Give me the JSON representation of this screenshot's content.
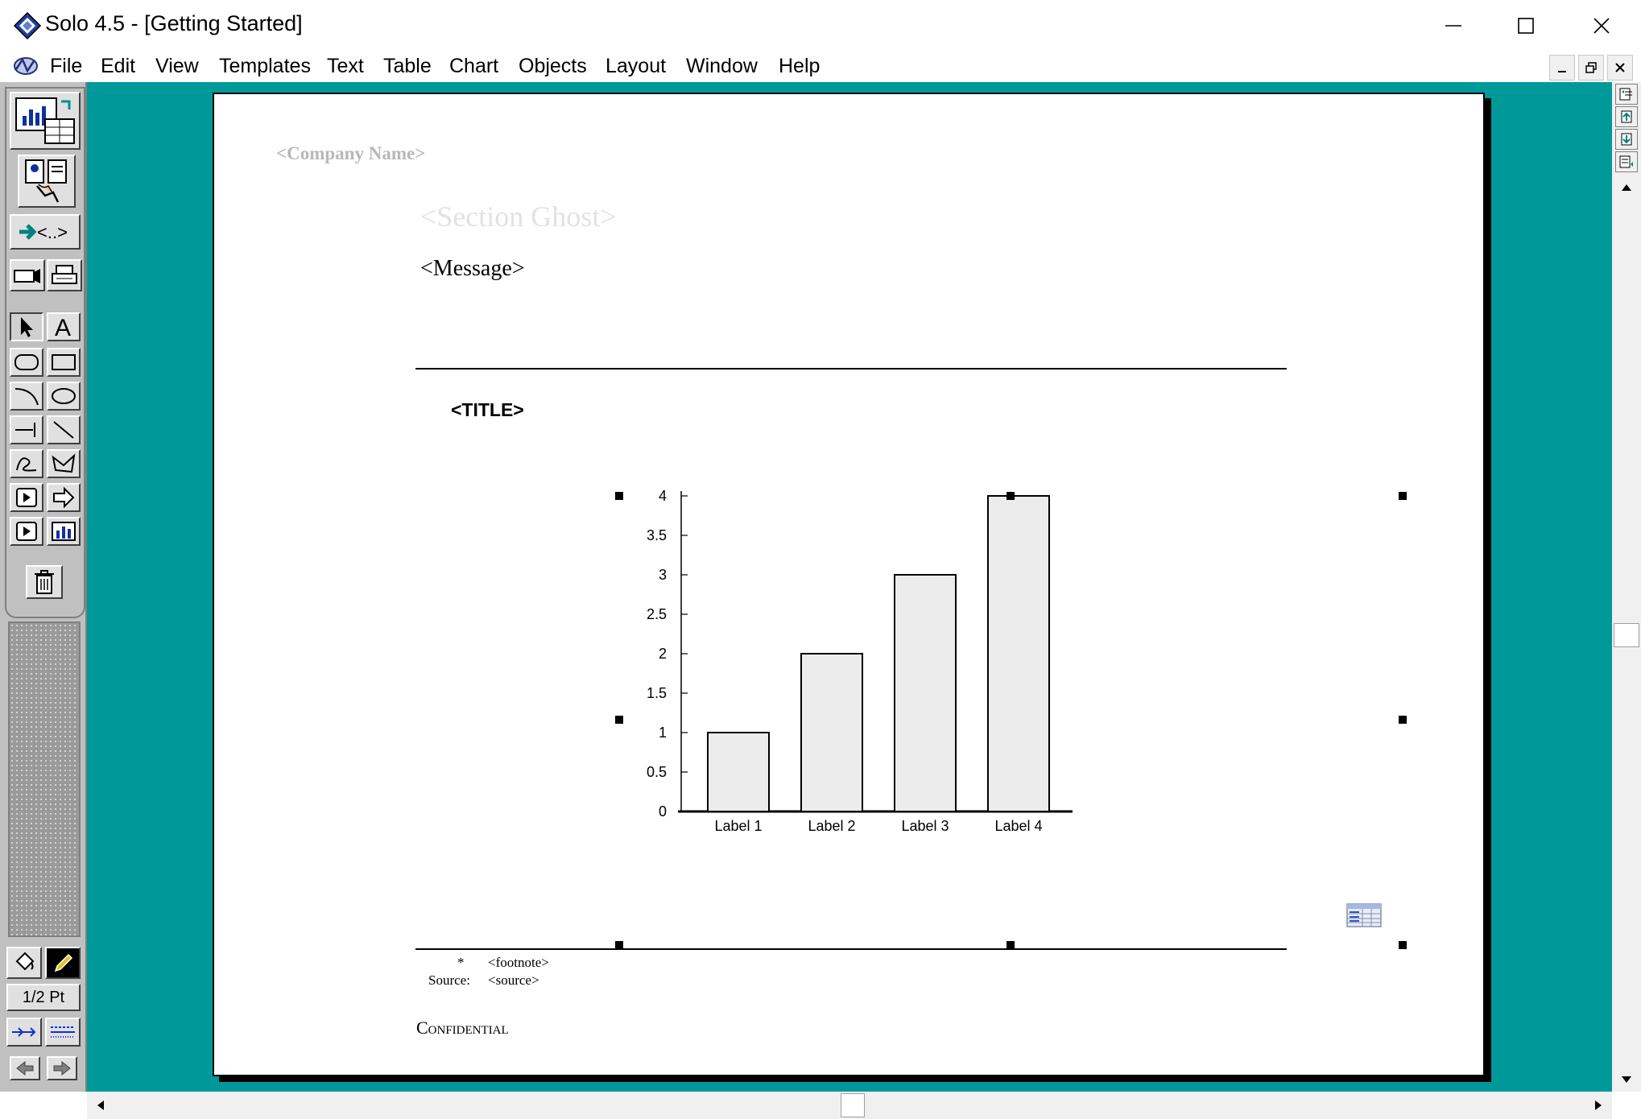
{
  "window": {
    "title": "Solo 4.5 - [Getting Started]"
  },
  "menu": {
    "items": [
      "File",
      "Edit",
      "View",
      "Templates",
      "Text",
      "Table",
      "Chart",
      "Objects",
      "Layout",
      "Window",
      "Help"
    ]
  },
  "toolbox": {
    "line_weight_label": "1/2 Pt",
    "tools": [
      "chart-gallery",
      "presentation",
      "tag-navigator",
      "slide-show",
      "print",
      "pointer",
      "text",
      "rounded-rectangle",
      "rectangle",
      "arc",
      "ellipse",
      "horizontal-line",
      "diagonal-line",
      "freehand",
      "polygon",
      "play-macro",
      "arrow-shape",
      "play-chart",
      "chart-insert",
      "trash"
    ]
  },
  "document": {
    "company_name": "<Company Name>",
    "section_ghost": "<Section Ghost>",
    "message": "<Message>",
    "title": "<TITLE>",
    "footnote_marker": "*",
    "footnote": "<footnote>",
    "source_label": "Source:",
    "source": "<source>",
    "confidential": "Confidential"
  },
  "chart_data": {
    "type": "bar",
    "categories": [
      "Label 1",
      "Label 2",
      "Label 3",
      "Label 4"
    ],
    "values": [
      1,
      2,
      3,
      4
    ],
    "yticks": [
      0,
      0.5,
      1,
      1.5,
      2,
      2.5,
      3,
      3.5,
      4
    ],
    "ylim": [
      0,
      4
    ],
    "grid": false,
    "bar_color": "#ececec"
  },
  "colors": {
    "workspace": "#009999",
    "toolbox": "#c0c0c0"
  }
}
